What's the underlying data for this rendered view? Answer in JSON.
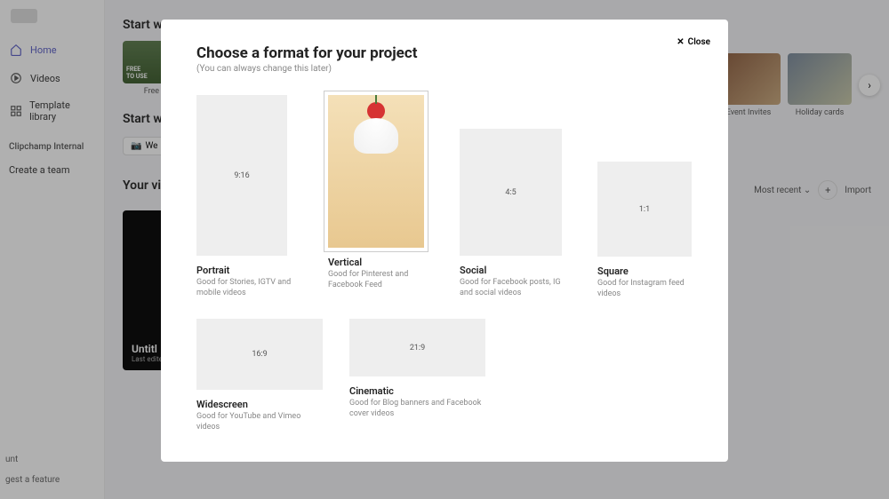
{
  "sidebar": {
    "items": [
      {
        "label": "Home",
        "icon": "home-icon"
      },
      {
        "label": "Videos",
        "icon": "videos-icon"
      },
      {
        "label": "Template library",
        "icon": "templates-icon"
      }
    ],
    "internal_label": "Clipchamp Internal",
    "create_team_label": "Create a team",
    "account_label": "unt",
    "suggest_label": "gest a feature"
  },
  "main": {
    "start_heading": "Start w",
    "start_heading2": "Start w",
    "videos_heading": "Your vi",
    "webcam_btn": "We",
    "free_card_label": "Free F",
    "free_card_text1": "FREE",
    "free_card_text2": "TO USE",
    "untitled_title": "Untitl",
    "untitled_sub": "Last edite",
    "sort_label": "Most recent",
    "import_label": "Import"
  },
  "right_cards": [
    {
      "label": "Event Invites"
    },
    {
      "label": "Holiday cards"
    }
  ],
  "modal": {
    "close_label": "Close",
    "title": "Choose a format for your project",
    "subtitle": "(You can always change this later)",
    "formats": [
      {
        "name": "Portrait",
        "ratio": "9:16",
        "desc": "Good for Stories, IGTV and mobile videos"
      },
      {
        "name": "Vertical",
        "ratio": "",
        "desc": "Good for Pinterest and Facebook Feed"
      },
      {
        "name": "Social",
        "ratio": "4:5",
        "desc": "Good for Facebook posts, IG and social videos"
      },
      {
        "name": "Square",
        "ratio": "1:1",
        "desc": "Good for Instagram feed videos"
      },
      {
        "name": "Widescreen",
        "ratio": "16:9",
        "desc": "Good for YouTube and Vimeo videos"
      },
      {
        "name": "Cinematic",
        "ratio": "21:9",
        "desc": "Good for Blog banners and Facebook cover videos"
      }
    ]
  }
}
